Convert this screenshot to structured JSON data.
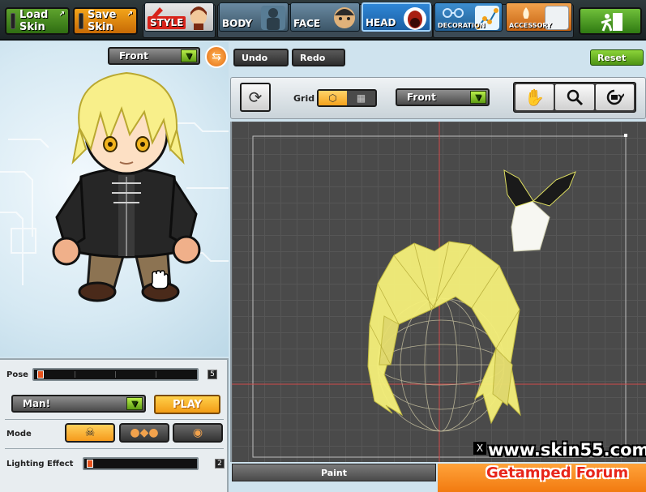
{
  "toolbar": {
    "load_skin": "Load Skin",
    "save_skin": "Save Skin",
    "tabs": {
      "style": "STYLE",
      "body": "BODY",
      "face": "FACE",
      "head": "HEAD",
      "decoration": "DECORATION",
      "accessory": "ACCESSORY"
    },
    "active_tab": "HEAD",
    "icons": [
      "style-icon",
      "body-icon",
      "face-icon",
      "head-icon",
      "decoration-icon",
      "accessory-icon",
      "exit-icon"
    ]
  },
  "preview": {
    "view_select": "Front",
    "undo": "Undo",
    "redo": "Redo"
  },
  "editor": {
    "reset": "Reset",
    "grid_label": "Grid",
    "view_select": "Front",
    "tools": [
      "hand-icon",
      "zoom-icon",
      "rotate-camera-icon"
    ]
  },
  "pose_panel": {
    "pose_label": "Pose",
    "pose_value": "5",
    "pose_fraction": 0.02,
    "pose_select": "Man!",
    "play": "PLAY",
    "mode_label": "Mode",
    "lighting_label": "Lighting Effect",
    "lighting_value": "2",
    "lighting_fraction": 0.02
  },
  "footer": {
    "paint_tab": "Paint",
    "watermark_url": "www.skin55.com",
    "watermark_forum": "Getamped Forum",
    "close": "X"
  },
  "colors": {
    "accent_orange": "#f5a21c",
    "accent_green": "#7cc72e",
    "canvas_bg": "#4a4a4a",
    "hair_yellow": "#f5f07a"
  }
}
